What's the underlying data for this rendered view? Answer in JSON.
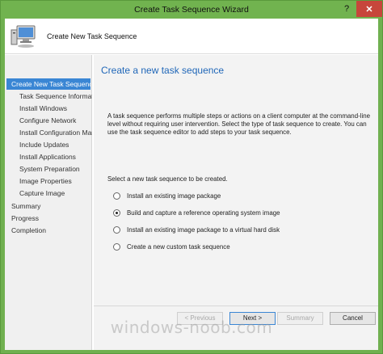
{
  "window": {
    "title": "Create Task Sequence Wizard",
    "help_glyph": "?",
    "close_glyph": "✕"
  },
  "header": {
    "title": "Create New Task Sequence"
  },
  "nav": {
    "items": [
      {
        "label": "Create New Task Sequence",
        "level": "top",
        "active": true
      },
      {
        "label": "Task Sequence Informati",
        "level": "sub",
        "active": false
      },
      {
        "label": "Install Windows",
        "level": "sub",
        "active": false
      },
      {
        "label": "Configure Network",
        "level": "sub",
        "active": false
      },
      {
        "label": "Install Configuration Mar",
        "level": "sub",
        "active": false
      },
      {
        "label": "Include Updates",
        "level": "sub",
        "active": false
      },
      {
        "label": "Install Applications",
        "level": "sub",
        "active": false
      },
      {
        "label": "System Preparation",
        "level": "sub",
        "active": false
      },
      {
        "label": "Image Properties",
        "level": "sub",
        "active": false
      },
      {
        "label": "Capture Image",
        "level": "sub",
        "active": false
      },
      {
        "label": "Summary",
        "level": "top",
        "active": false
      },
      {
        "label": "Progress",
        "level": "top",
        "active": false
      },
      {
        "label": "Completion",
        "level": "top",
        "active": false
      }
    ]
  },
  "main": {
    "heading": "Create a new task sequence",
    "description": "A task sequence performs multiple steps or actions on a client computer at the command-line level without requiring user intervention. Select the type of task sequence to create. You can use the task sequence editor to add steps to your task sequence.",
    "select_label": "Select a new task sequence to be created.",
    "options": [
      {
        "label": "Install an existing image package",
        "checked": false
      },
      {
        "label": "Build and capture a reference operating system image",
        "checked": true
      },
      {
        "label": "Install an existing image package to a virtual hard disk",
        "checked": false
      },
      {
        "label": "Create a new custom task sequence",
        "checked": false
      }
    ]
  },
  "footer": {
    "previous_label": "< Previous",
    "next_label": "Next >",
    "summary_label": "Summary",
    "cancel_label": "Cancel"
  },
  "watermark": "windows-noob.com",
  "colors": {
    "titlebar": "#71b34f",
    "close": "#c7463b",
    "accent": "#3a86d4",
    "heading": "#2067b8"
  }
}
